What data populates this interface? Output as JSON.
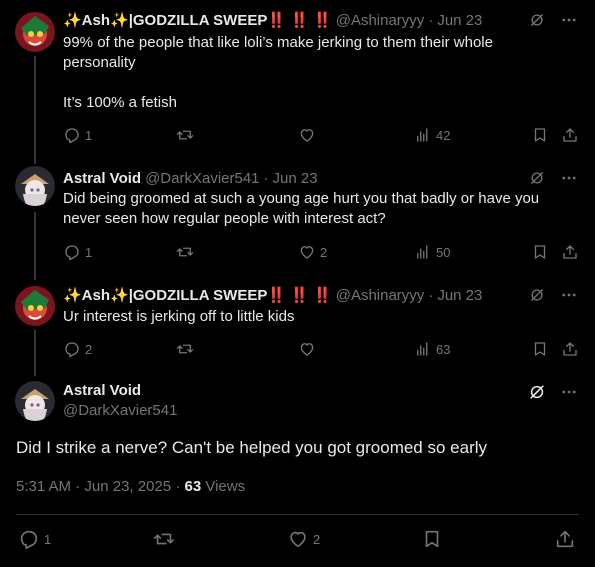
{
  "colors": {
    "background": "#000000",
    "text": "#e7e9ea",
    "muted": "#71767b",
    "divider": "#2f3336"
  },
  "tweets": [
    {
      "display_name": "✨Ash✨|GODZILLA SWEEP",
      "emphasis": "‼️ ‼️ ‼️",
      "handle": "@Ashinaryyy",
      "dot": "·",
      "date": "Jun 23",
      "text": "99% of the people that like loli’s make jerking to them their whole personality\n\nIt’s 100% a fetish",
      "replies": "1",
      "retweets": "",
      "likes": "",
      "views": "42"
    },
    {
      "display_name": "Astral Void",
      "handle": "@DarkXavier541",
      "dot": "·",
      "date": "Jun 23",
      "text": "Did being groomed at such a young age hurt you that badly or have you never seen how regular people with interest act?",
      "replies": "1",
      "retweets": "",
      "likes": "2",
      "views": "50"
    },
    {
      "display_name": "✨Ash✨|GODZILLA SWEEP",
      "emphasis": "‼️ ‼️ ‼️",
      "handle": "@Ashinaryyy",
      "dot": "·",
      "date": "Jun 23",
      "text": "Ur interest is jerking off to little kids",
      "replies": "2",
      "retweets": "",
      "likes": "",
      "views": "63"
    }
  ],
  "main_tweet": {
    "display_name": "Astral Void",
    "handle": "@DarkXavier541",
    "text": "Did I strike a nerve? Can't be helped you got groomed so early",
    "time": "5:31 AM",
    "dot": "·",
    "date": "Jun 23, 2025",
    "dot2": "·",
    "views_count": "63",
    "views_label": "Views",
    "replies": "1",
    "likes": "2"
  },
  "icons": [
    "reply-icon",
    "retweet-icon",
    "like-icon",
    "views-icon",
    "bookmark-icon",
    "share-icon",
    "grok-icon",
    "more-icon"
  ]
}
